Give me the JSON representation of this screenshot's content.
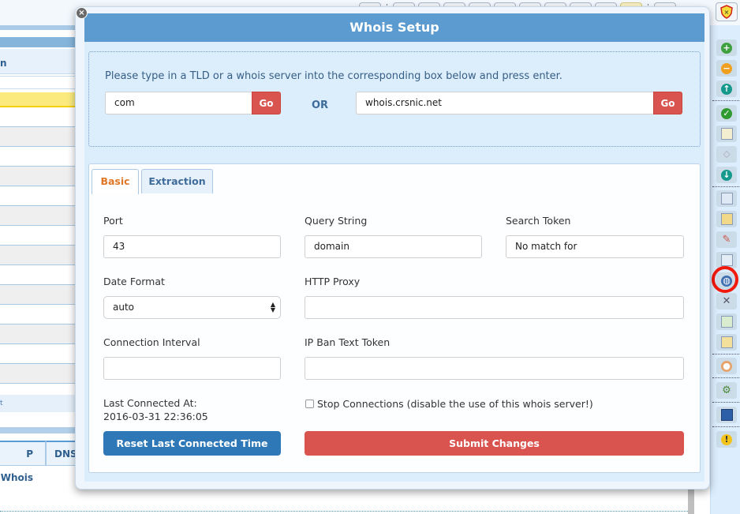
{
  "background": {
    "column_header_fragment": "n",
    "footer_fragment": "t",
    "bottom_tabs": [
      "P Whois",
      "DNS"
    ],
    "top_toolbar_icons": [
      "list-icon",
      "calendar-icon",
      "image-icon",
      "globe-icon",
      "window-icon",
      "search-icon",
      "pencil-icon",
      "magnifier-icon",
      "window-icon",
      "window-icon",
      "window-icon",
      "cloud-icon"
    ],
    "shield_icon": "shield-icon"
  },
  "right_sidebar": {
    "icons": [
      "add-icon",
      "remove-icon",
      "up-icon",
      "check-icon",
      "settings-doc-icon",
      "tag-icon",
      "down-icon",
      "add-table-icon",
      "folder-settings-icon",
      "edit-settings-icon",
      "table-settings-icon",
      "globe-settings-icon",
      "tools-icon",
      "id-check-icon",
      "clipboard-check-icon",
      "palette-icon",
      "gear-check-icon",
      "book-icon",
      "warning-lock-icon"
    ],
    "highlighted_icon": "globe-settings-icon"
  },
  "modal": {
    "title": "Whois Setup",
    "instruction": "Please type in a TLD or a whois server into the corresponding box below and press enter.",
    "tld_input": {
      "value": "com"
    },
    "tld_go_label": "Go",
    "or_label": "OR",
    "server_input": {
      "value": "whois.crsnic.net"
    },
    "server_go_label": "Go",
    "tabs": [
      {
        "label": "Basic",
        "active": true
      },
      {
        "label": "Extraction",
        "active": false
      }
    ],
    "fields": {
      "port": {
        "label": "Port",
        "value": "43"
      },
      "query_string": {
        "label": "Query String",
        "value": "domain"
      },
      "search_token": {
        "label": "Search Token",
        "value": "No match for"
      },
      "date_format": {
        "label": "Date Format",
        "value": "auto"
      },
      "http_proxy": {
        "label": "HTTP Proxy",
        "value": ""
      },
      "connection_interval": {
        "label": "Connection Interval",
        "value": ""
      },
      "ip_ban_text_token": {
        "label": "IP Ban Text Token",
        "value": ""
      }
    },
    "last_connected_label": "Last Connected At:",
    "last_connected_value": "2016-03-31 22:36:05",
    "stop_connections_label": "Stop Connections (disable the use of this whois server!)",
    "stop_connections_checked": false,
    "reset_button": "Reset Last Connected Time",
    "submit_button": "Submit Changes"
  },
  "colors": {
    "title_bar": "#5b9bd0",
    "go_button": "#d9534f",
    "reset_button": "#2e78b7",
    "submit_button": "#d9534f",
    "active_tab_text": "#e07726",
    "annotation": "#f2190d"
  }
}
